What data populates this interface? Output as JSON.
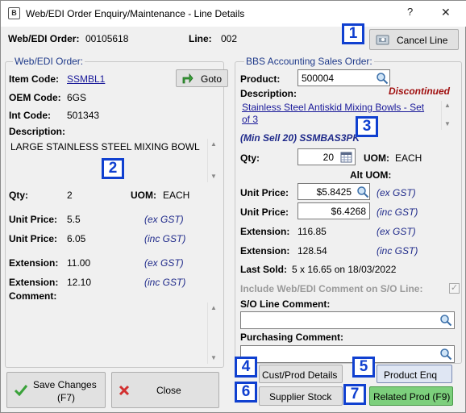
{
  "window": {
    "title": "Web/EDI Order Enquiry/Maintenance - Line Details",
    "help_glyph": "?",
    "close_glyph": "✕",
    "app_glyph": "B"
  },
  "header": {
    "order_label": "Web/EDI Order:",
    "order_value": "00105618",
    "line_label": "Line:",
    "line_value": "002",
    "cancel_line_label": "Cancel Line"
  },
  "left": {
    "group_title": "Web/EDI Order:",
    "item_code_label": "Item Code:",
    "item_code_value": "SSMBL1",
    "goto_label": "Goto",
    "oem_code_label": "OEM Code:",
    "oem_code_value": "6GS",
    "int_code_label": "Int Code:",
    "int_code_value": "501343",
    "description_label": "Description:",
    "description_value": "LARGE STAINLESS STEEL MIXING BOWL",
    "qty_label": "Qty:",
    "qty_value": "2",
    "uom_label": "UOM:",
    "uom_value": "EACH",
    "unit_price_label_1": "Unit Price:",
    "unit_price_value_1": "5.5",
    "unit_price_note_1": "(ex GST)",
    "unit_price_label_2": "Unit Price:",
    "unit_price_value_2": "6.05",
    "unit_price_note_2": "(inc GST)",
    "extension_label_1": "Extension:",
    "extension_value_1": "11.00",
    "extension_note_1": "(ex GST)",
    "extension_label_2": "Extension:",
    "extension_value_2": "12.10",
    "extension_note_2": "(inc GST)",
    "comment_label": "Comment:"
  },
  "right": {
    "group_title": "BBS Accounting Sales Order:",
    "product_label": "Product:",
    "product_value": "500004",
    "description_label": "Description:",
    "discontinued": "Discontinued",
    "description_line_1": "Stainless Steel Antiskid Mixing Bowls - Set",
    "description_line_2": "of 3",
    "min_sell": "(Min Sell 20) SSMBAS3PK",
    "qty_label": "Qty:",
    "qty_value": "20",
    "uom_label": "UOM:",
    "uom_value": "EACH",
    "alt_uom_label": "Alt UOM:",
    "unit_price_label_1": "Unit Price:",
    "unit_price_value_1": "$5.8425",
    "unit_price_note_1": "(ex GST)",
    "unit_price_label_2": "Unit Price:",
    "unit_price_value_2": "$6.4268",
    "unit_price_note_2": "(inc GST)",
    "extension_label_1": "Extension:",
    "extension_value_1": "116.85",
    "extension_note_1": "(ex GST)",
    "extension_label_2": "Extension:",
    "extension_value_2": "128.54",
    "extension_note_2": "(inc GST)",
    "last_sold_label": "Last Sold:",
    "last_sold_value": "5 x 16.65 on 18/03/2022",
    "include_comment_label": "Include Web/EDI Comment on S/O Line:",
    "so_line_comment_label": "S/O Line Comment:",
    "purchasing_comment_label": "Purchasing Comment:"
  },
  "buttons": {
    "save_line_1": "Save Changes",
    "save_line_2": "(F7)",
    "close": "Close",
    "cust_prod_details": "Cust/Prod Details",
    "product_enq": "Product Enq",
    "supplier_stock": "Supplier Stock",
    "related_prod": "Related Prod (F9)"
  },
  "markers": [
    "1",
    "2",
    "3",
    "4",
    "5",
    "6",
    "7"
  ],
  "colors": {
    "marker_blue": "#1040d0",
    "related_green": "#7ccf7c",
    "discontinued_red": "#a01010",
    "link_blue": "#1a1a9a"
  },
  "icons": {
    "app": "app-icon",
    "cancel": "cancel-line-icon",
    "goto": "goto-arrow-icon",
    "search": "magnifier-icon",
    "calendar": "calendar-icon",
    "save": "checkmark-icon",
    "close": "red-x-icon"
  }
}
